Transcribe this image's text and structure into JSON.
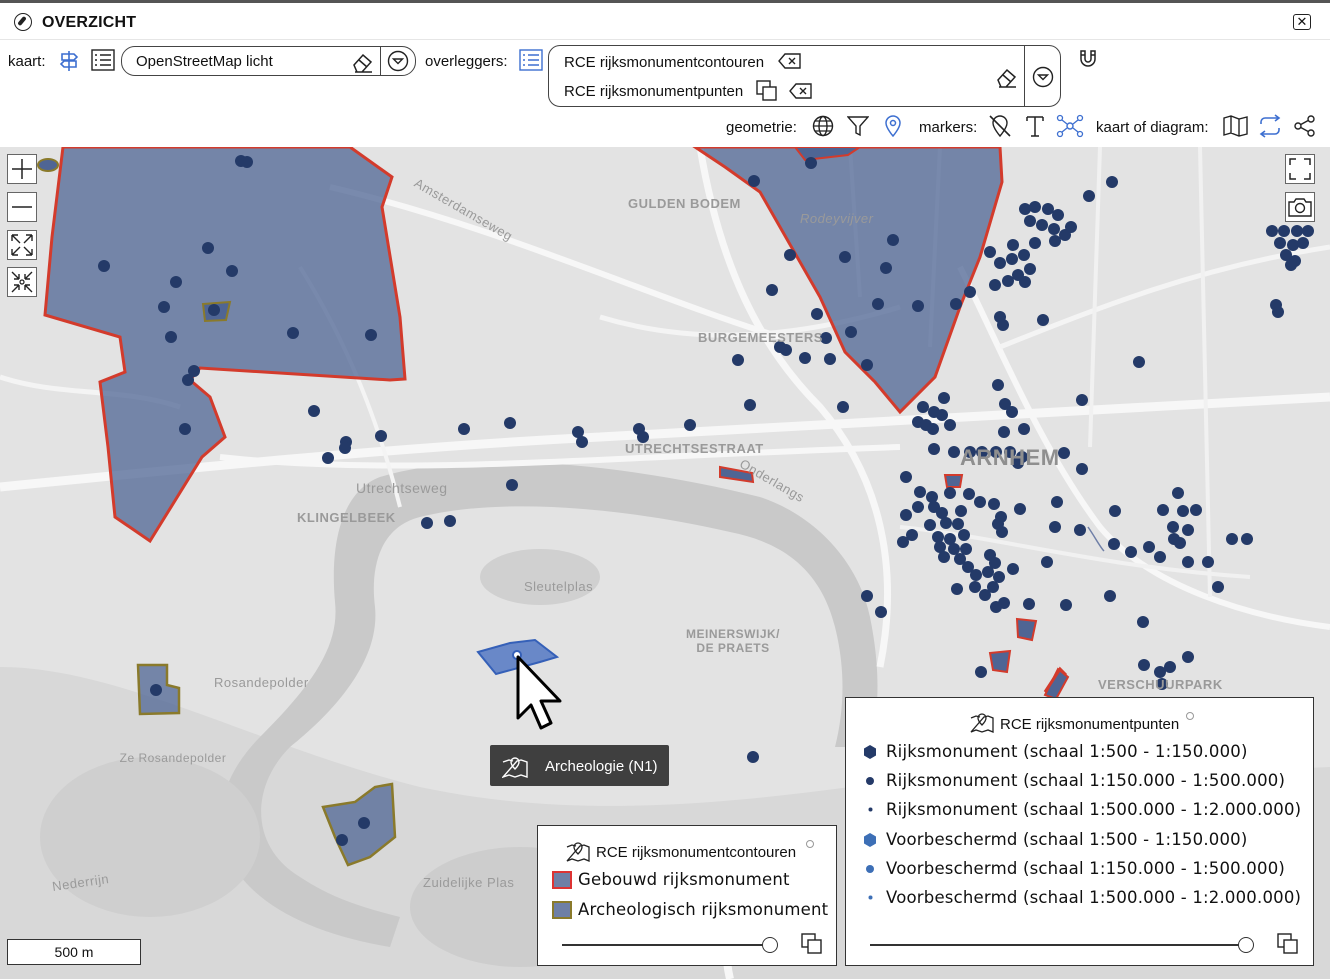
{
  "window": {
    "title": "OVERZICHT"
  },
  "toolbar": {
    "kaart_label": "kaart:",
    "basemap_value": "OpenStreetMap licht",
    "overlays_label": "overleggers:",
    "overlays": [
      "RCE rijksmonumentcontouren",
      "RCE rijksmonumentpunten"
    ],
    "geometry_label": "geometrie:",
    "markers_label": "markers:",
    "mapdiagram_label": "kaart of diagram:"
  },
  "map": {
    "tooltip": "Archeologie (N1)",
    "scale": "500 m",
    "place_labels": [
      "GULDEN BODEM",
      "BURGEMEESTERS",
      "UTRECHTSESTRAAT",
      "Utrechtseweg",
      "KLINGELBEEK",
      "Sleutelplas",
      "MEINERSWIJK/ DE PRAETS",
      "Rosandepolder",
      "Ze Rosandepolder",
      "Nederrijn",
      "Zuidelijke Plas",
      "ARNHEM",
      "VERSCHUURPARK",
      "Rodeyvijver",
      "Amsterdamseweg",
      "Onderlangs"
    ]
  },
  "legend_contours": {
    "title": "RCE rijksmonumentcontouren",
    "items": [
      "Gebouwd rijksmonument",
      "Archeologisch rijksmonument"
    ],
    "colors": {
      "built_border": "#d9362b",
      "arch_border": "#8a7a2b",
      "fill": "#6f7fa7"
    }
  },
  "legend_points": {
    "title": "RCE rijksmonumentpunten",
    "items": [
      "Rijksmonument (schaal 1:500 - 1:150.000)",
      "Rijksmonument (schaal 1:150.000 - 1:500.000)",
      "Rijksmonument (schaal 1:500.000 - 1:2.000.000)",
      "Voorbeschermd (schaal 1:500 - 1:150.000)",
      "Voorbeschermd (schaal 1:150.000 - 1:500.000)",
      "Voorbeschermd (schaal 1:500.000 - 1:2.000.000)"
    ],
    "colors": {
      "rijks": "#243a68",
      "voor": "#3d6fb6"
    }
  }
}
